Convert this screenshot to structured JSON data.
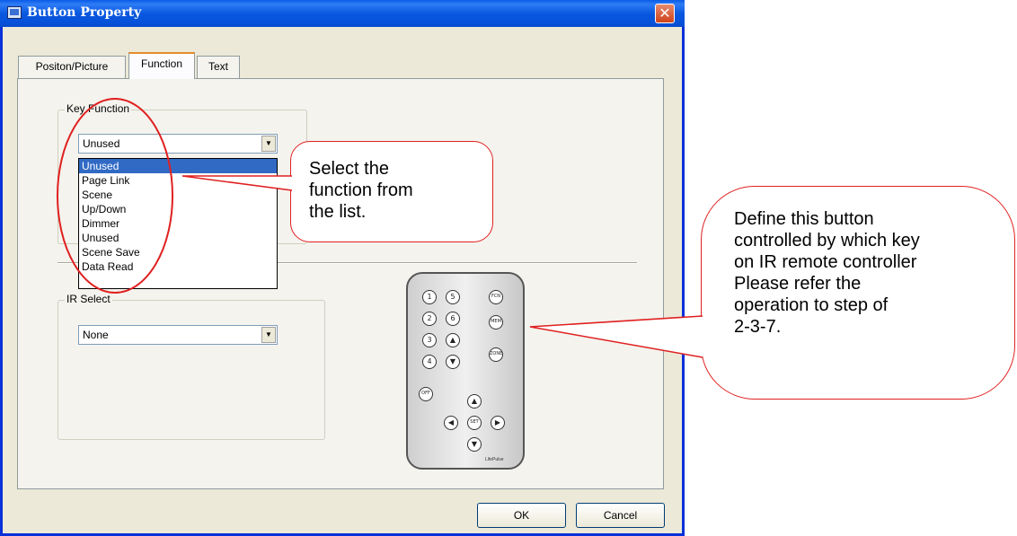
{
  "window": {
    "title": "Button Property",
    "close_symbol": "✕"
  },
  "tabs": [
    {
      "label": "Positon/Picture"
    },
    {
      "label": "Function"
    },
    {
      "label": "Text"
    }
  ],
  "key_function": {
    "group_label": "Key Function",
    "selected": "Unused",
    "options": [
      "Unused",
      "Page Link",
      "Scene",
      "Up/Down",
      "Dimmer",
      "Unused",
      "Scene Save",
      "Data Read"
    ],
    "highlighted_index": 0
  },
  "ir_select": {
    "group_label": "IR Select",
    "selected": "None"
  },
  "remote": {
    "keys": [
      "1",
      "5",
      "FCN",
      "2",
      "6",
      "MEM",
      "3",
      "▲",
      "4",
      "▼",
      "ZONE",
      "OFF",
      "▲",
      "◀",
      "SET",
      "▶",
      "▼"
    ],
    "brand": "LifePulse"
  },
  "buttons": {
    "ok": "OK",
    "cancel": "Cancel"
  },
  "callouts": {
    "select": [
      "Select the",
      "function from",
      "the list."
    ],
    "define": [
      "Define this button",
      "controlled by which key",
      "on IR remote controller",
      "Please refer the",
      "operation to step of",
      "2-3-7."
    ]
  },
  "colors": {
    "callout_border": "#e02020",
    "titlebar": "#0a58e0",
    "selection": "#316ac5"
  }
}
